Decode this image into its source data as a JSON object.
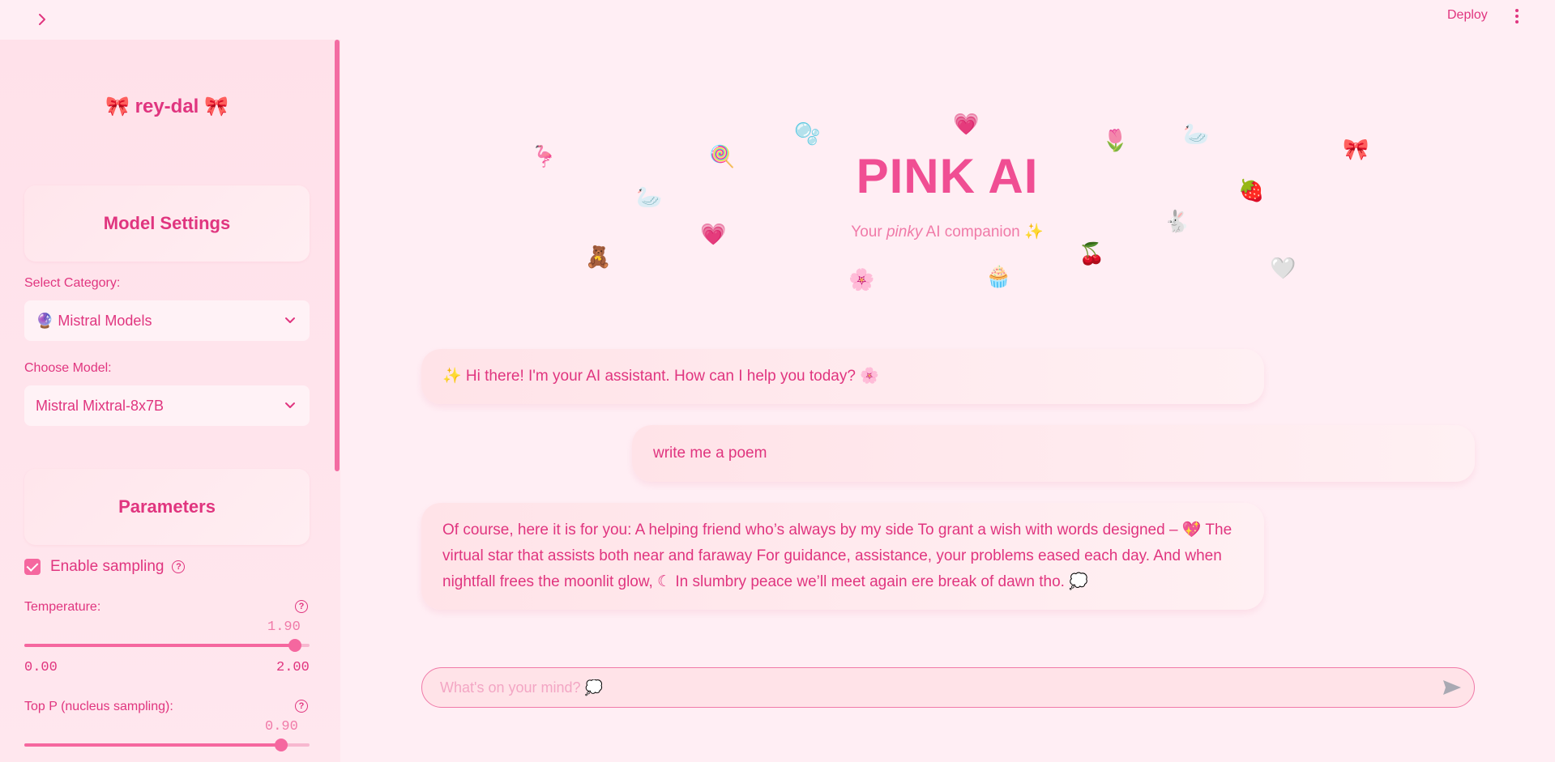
{
  "header": {
    "deploy_label": "Deploy"
  },
  "sidebar": {
    "brand": "🎀 rey-dal 🎀",
    "model_settings_title": "Model Settings",
    "category_label": "Select Category:",
    "category_value": "🔮 Mistral Models",
    "model_label": "Choose Model:",
    "model_value": "Mistral Mixtral-8x7B",
    "parameters_title": "Parameters",
    "sampling_label": "Enable sampling",
    "sampling_checked": true,
    "temperature": {
      "label": "Temperature:",
      "value": "1.90",
      "min": "0.00",
      "max": "2.00",
      "fraction": 0.95
    },
    "top_p": {
      "label": "Top P (nucleus sampling):",
      "value": "0.90",
      "fraction": 0.9
    }
  },
  "main": {
    "title": "PINK AI",
    "subtitle_pre": "Your ",
    "subtitle_em": "pinky",
    "subtitle_post": " AI companion ✨",
    "decorations": [
      "🦩",
      "🍭",
      "🫧",
      "💗",
      "🌷",
      "🦢",
      "🎀",
      "🦢",
      "🍓",
      "💗",
      "🐇",
      "🧸",
      "🌸",
      "🧁",
      "🍒",
      "🤍"
    ]
  },
  "chat": {
    "messages": [
      {
        "role": "assistant",
        "text": "✨ Hi there! I'm your AI assistant. How can I help you today? 🌸"
      },
      {
        "role": "user",
        "text": "write me a poem"
      },
      {
        "role": "assistant",
        "text": "Of course, here it is for you: A helping friend who’s always by my side To grant a wish with words designed – 💖 The virtual star that assists both near and faraway For guidance, assistance, your problems eased each day. And when nightfall frees the moonlit glow, ☾ In slumbry peace we’ll meet again ere break of dawn tho. 💭"
      }
    ],
    "input_placeholder": "What's on your mind? 💭",
    "input_value": ""
  },
  "colors": {
    "accent": "#e0357f",
    "title": "#f04e93",
    "background": "#ffeef4",
    "sidebar": "#ffe1ea"
  }
}
